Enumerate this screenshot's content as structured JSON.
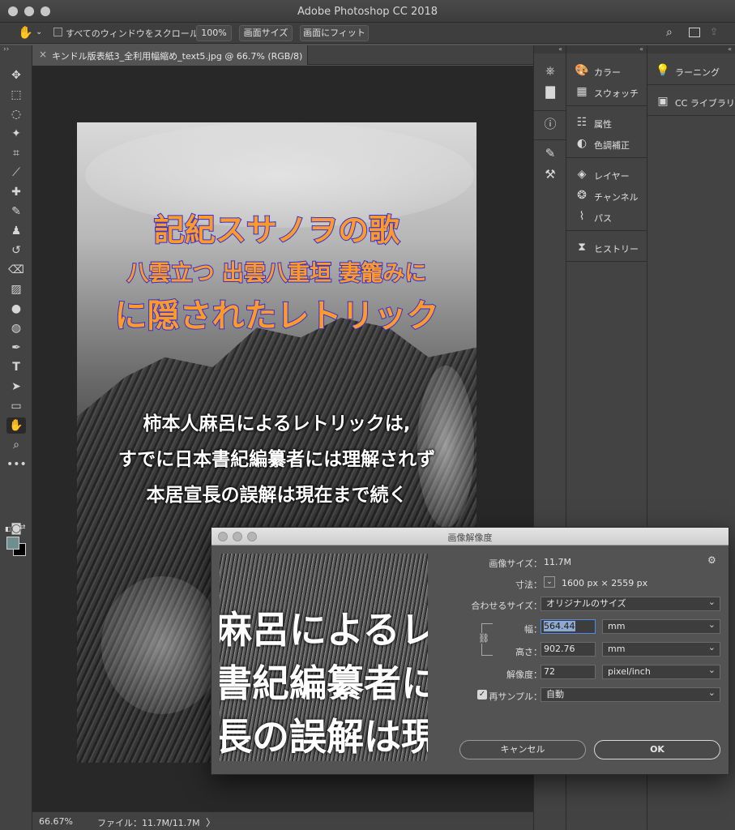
{
  "window": {
    "title": "Adobe Photoshop CC 2018"
  },
  "options_bar": {
    "scroll_all_label": "すべてのウィンドウをスクロール",
    "zoom_100_label": "100%",
    "image_size_label": "画面サイズ",
    "fit_screen_label": "画面にフィット"
  },
  "document_tab": {
    "label": "キンドル版表紙3_全利用幅縮め_text5.jpg @ 66.7% (RGB/8)",
    "close": "×"
  },
  "document": {
    "title_line1": "記紀スサノヲの歌",
    "title_line2": "八雲立つ 出雲八重垣 妻籠みに",
    "title_line3": "に隠されたレトリック",
    "body_line1": "柿本人麻呂によるレトリックは,",
    "body_line2": "すでに日本書紀編纂者には理解されず",
    "body_line3": "本居宣長の誤解は現在まで続く"
  },
  "status_bar": {
    "zoom": "66.67%",
    "file_info": "ファイル：11.7M/11.7M",
    "arrow": "〉"
  },
  "panels": {
    "col1": [
      {
        "label": "カラー",
        "icon": "palette-icon"
      },
      {
        "label": "スウォッチ",
        "icon": "grid-icon"
      },
      {
        "label": "属性",
        "icon": "properties-icon"
      },
      {
        "label": "色調補正",
        "icon": "adjustments-icon"
      },
      {
        "label": "レイヤー",
        "icon": "layers-icon"
      },
      {
        "label": "チャンネル",
        "icon": "channels-icon"
      },
      {
        "label": "パス",
        "icon": "paths-icon"
      },
      {
        "label": "ヒストリー",
        "icon": "history-icon"
      }
    ],
    "col2": [
      {
        "label": "ラーニング",
        "icon": "lightbulb-icon"
      },
      {
        "label": "CC ライブラリ",
        "icon": "library-icon"
      }
    ]
  },
  "dialog": {
    "title": "画像解像度",
    "image_size_label": "画像サイズ：",
    "image_size_value": "11.7M",
    "dimensions_label": "寸法：",
    "dimensions_value": "1600 px × 2559 px",
    "fit_to_label": "合わせるサイズ：",
    "fit_to_value": "オリジナルのサイズ",
    "width_label": "幅：",
    "width_value": "564.44",
    "width_unit": "mm",
    "height_label": "高さ：",
    "height_value": "902.76",
    "height_unit": "mm",
    "resolution_label": "解像度：",
    "resolution_value": "72",
    "resolution_unit": "pixel/inch",
    "resample_label": "再サンプル：",
    "resample_value": "自動",
    "cancel_label": "キャンセル",
    "ok_label": "OK",
    "preview_line1": "麻呂によるレトリ",
    "preview_line2": "書紀編纂者には",
    "preview_line3": "長の誤解は現在"
  },
  "colors": {
    "foreground": "#6f8e90",
    "background": "#000000",
    "title_fill": "#ff9a2a",
    "title_stroke": "#3232d8"
  }
}
